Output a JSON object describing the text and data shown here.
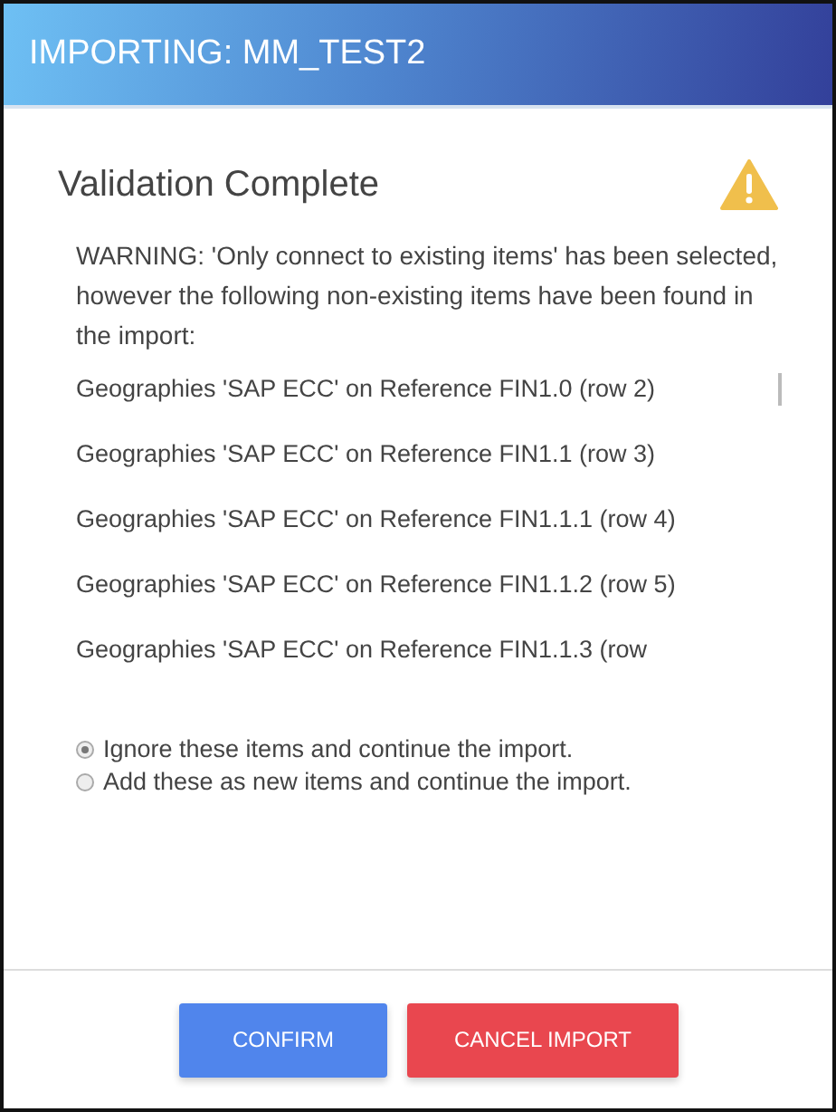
{
  "window": {
    "title": "IMPORTING: MM_TEST2"
  },
  "heading": "Validation Complete",
  "warning": "WARNING: 'Only connect to existing items' has been selected, however the following non-existing items have been found in the import:",
  "items": [
    "Geographies 'SAP ECC' on Reference FIN1.0 (row 2)",
    "Geographies 'SAP ECC' on Reference FIN1.1 (row 3)",
    "Geographies 'SAP ECC' on Reference FIN1.1.1 (row 4)",
    "Geographies 'SAP ECC' on Reference FIN1.1.2 (row 5)",
    "Geographies 'SAP ECC' on Reference FIN1.1.3 (row"
  ],
  "options": [
    {
      "label": "Ignore these items and continue the import.",
      "selected": true
    },
    {
      "label": "Add these as new items and continue the import.",
      "selected": false
    }
  ],
  "buttons": [
    {
      "label": "CONFIRM",
      "kind": "primary"
    },
    {
      "label": "CANCEL IMPORT",
      "kind": "danger"
    }
  ]
}
